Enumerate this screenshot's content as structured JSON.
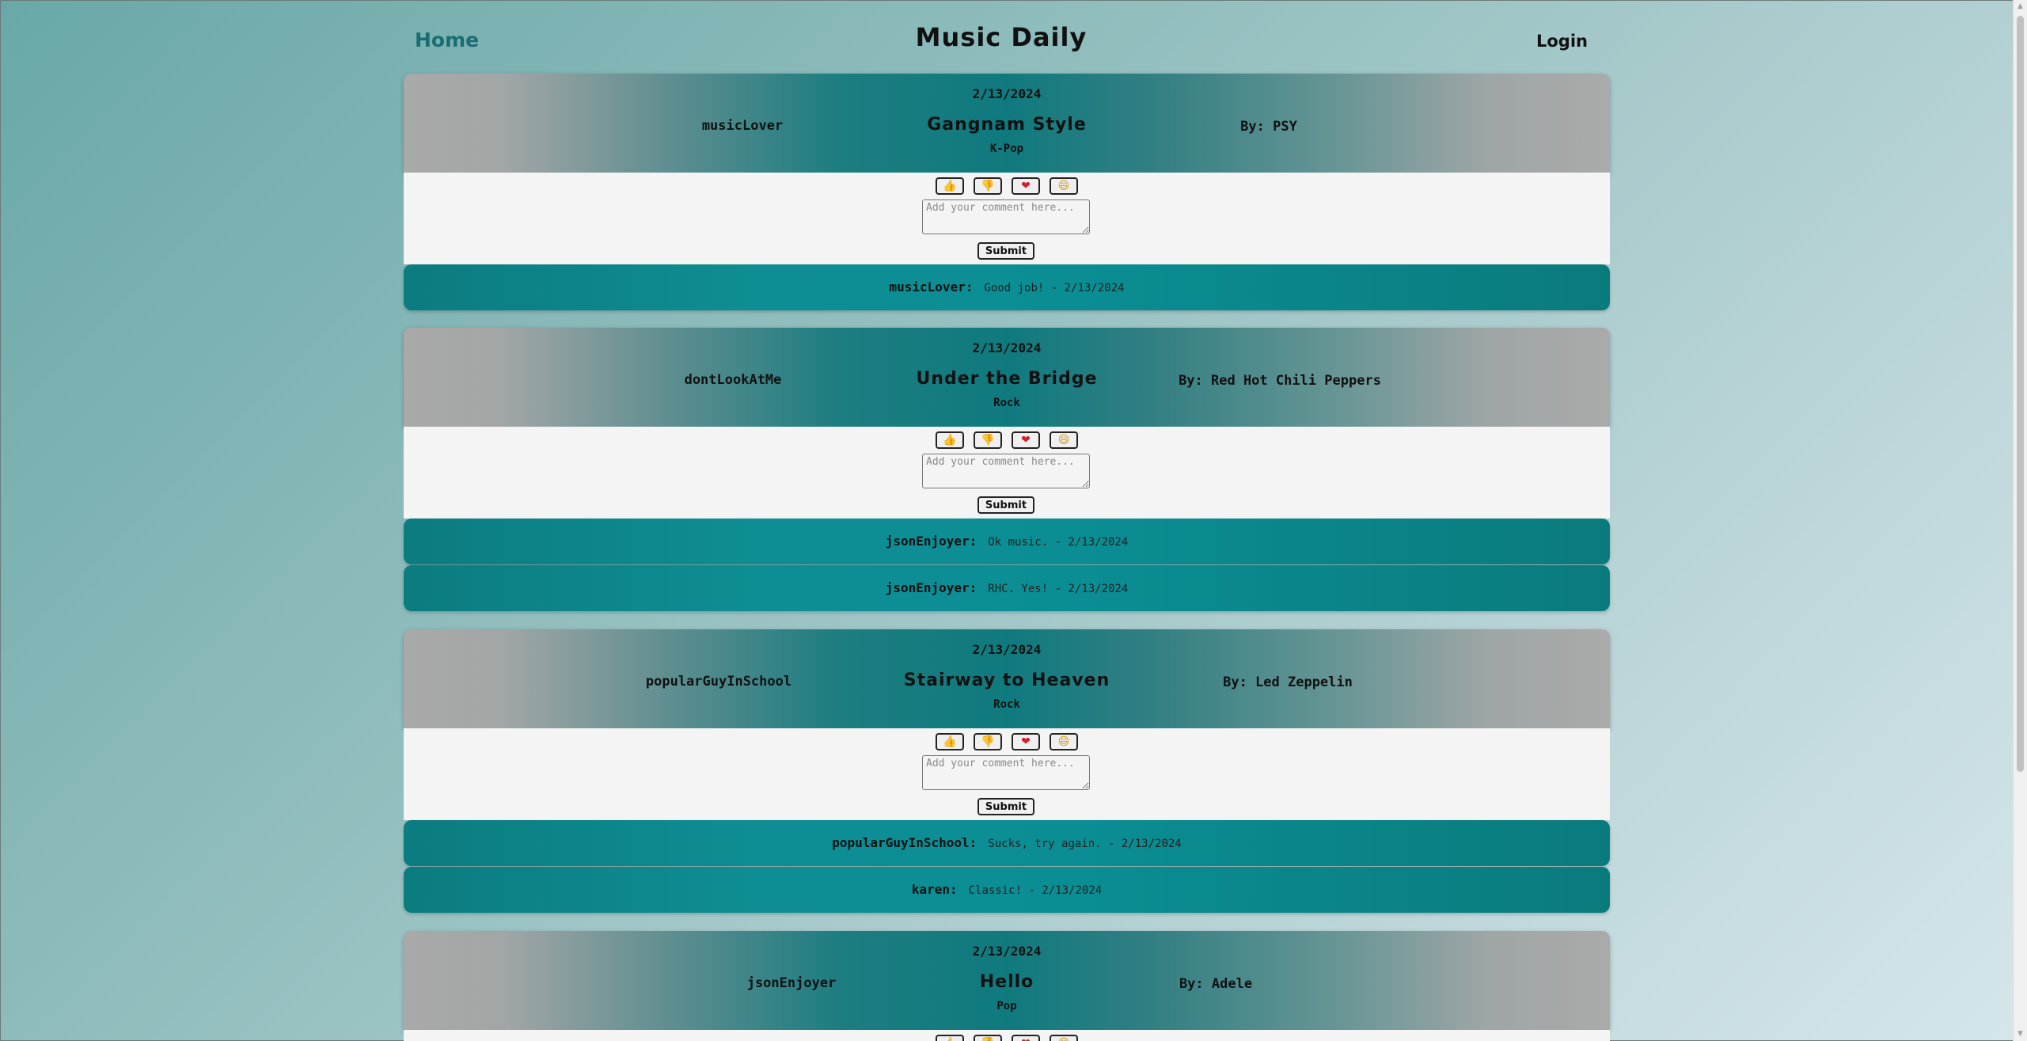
{
  "nav": {
    "home": "Home",
    "title": "Music Daily",
    "login": "Login"
  },
  "reactions": {
    "like": "👍",
    "dislike": "👎",
    "love": "❤",
    "laugh": "😄"
  },
  "comment_placeholder": "Add your comment here...",
  "submit_label": "Submit",
  "posts": [
    {
      "date": "2/13/2024",
      "user": "musicLover",
      "song": "Gangnam Style",
      "genre": "K-Pop",
      "artist": "By: PSY",
      "comments": [
        {
          "user": "musicLover:",
          "text": "Good job! - 2/13/2024"
        }
      ]
    },
    {
      "date": "2/13/2024",
      "user": "dontLookAtMe",
      "song": "Under the Bridge",
      "genre": "Rock",
      "artist": "By: Red Hot Chili Peppers",
      "comments": [
        {
          "user": "jsonEnjoyer:",
          "text": "Ok music. - 2/13/2024"
        },
        {
          "user": "jsonEnjoyer:",
          "text": "RHC. Yes! - 2/13/2024"
        }
      ]
    },
    {
      "date": "2/13/2024",
      "user": "popularGuyInSchool",
      "song": "Stairway to Heaven",
      "genre": "Rock",
      "artist": "By: Led Zeppelin",
      "comments": [
        {
          "user": "popularGuyInSchool:",
          "text": "Sucks, try again. - 2/13/2024"
        },
        {
          "user": "karen:",
          "text": "Classic! - 2/13/2024"
        }
      ]
    },
    {
      "date": "2/13/2024",
      "user": "jsonEnjoyer",
      "song": "Hello",
      "genre": "Pop",
      "artist": "By: Adele",
      "comments": []
    }
  ]
}
